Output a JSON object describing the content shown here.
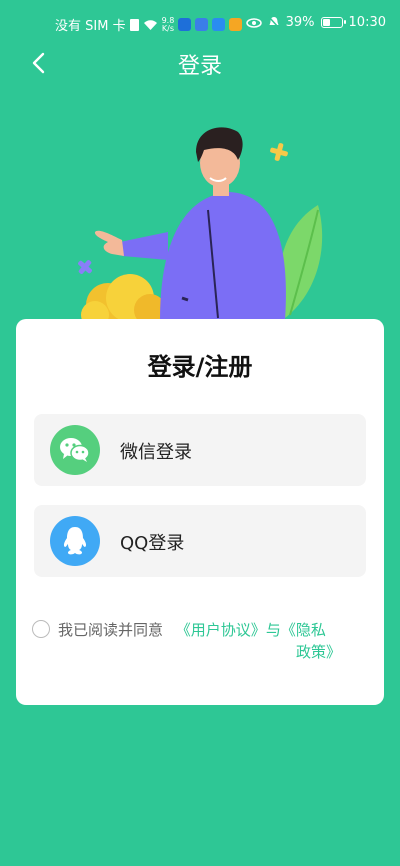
{
  "status_bar": {
    "carrier": "没有 SIM 卡",
    "net_speed_value": "9.8",
    "net_speed_unit": "K/s",
    "battery": "39%",
    "time": "10:30"
  },
  "nav": {
    "title": "登录"
  },
  "card": {
    "title": "登录/注册",
    "options": [
      {
        "label": "微信登录",
        "icon": "wechat-icon",
        "color": "#55cf7e"
      },
      {
        "label": "QQ登录",
        "icon": "qq-icon",
        "color": "#40a9f5"
      }
    ],
    "agreement": {
      "prefix": "我已阅读并同意",
      "user_agreement": "《用户协议》",
      "connector": "与",
      "privacy_line1": "《隐私",
      "privacy_line2": "政策》"
    }
  },
  "colors": {
    "background": "#2ec795",
    "accent": "#2ec795"
  }
}
